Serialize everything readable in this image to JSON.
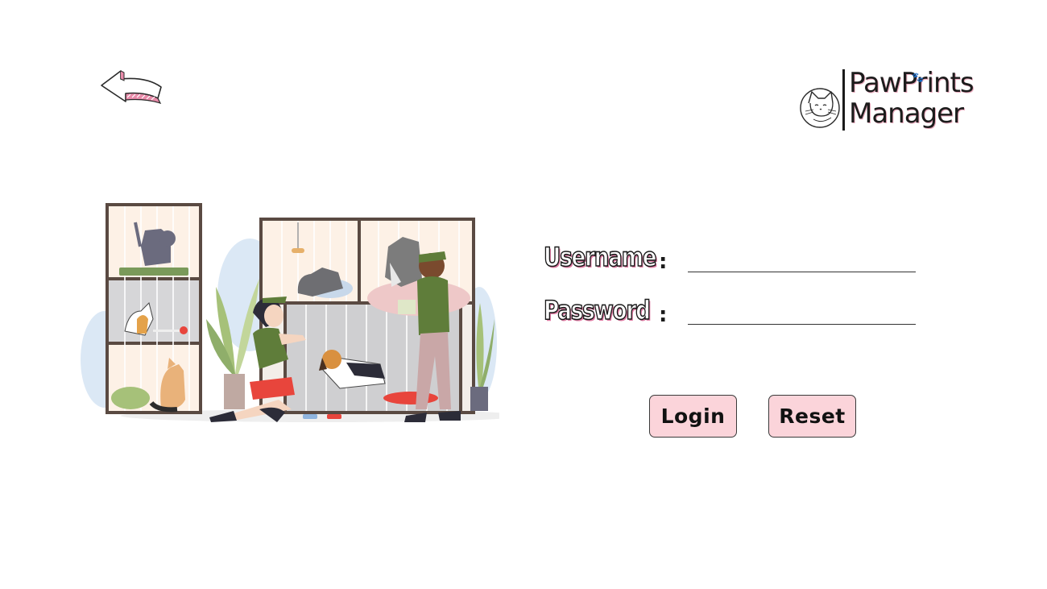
{
  "header": {
    "back_icon": "back-arrow-icon",
    "logo": {
      "line1": "PawPrints",
      "line2": "Manager",
      "icon": "cat-icon",
      "paw_glyph": "🐾"
    }
  },
  "illustration": {
    "subject": "pet-shelter-illustration"
  },
  "login_form": {
    "username_label": "Username",
    "password_label": "Password",
    "colon": ":",
    "username_value": "",
    "password_value": "",
    "login_label": "Login",
    "reset_label": "Reset"
  },
  "colors": {
    "button_bg": "#fbd4da",
    "label_shadow": "#e07ba3",
    "accent_pink": "#e9a9bc"
  }
}
